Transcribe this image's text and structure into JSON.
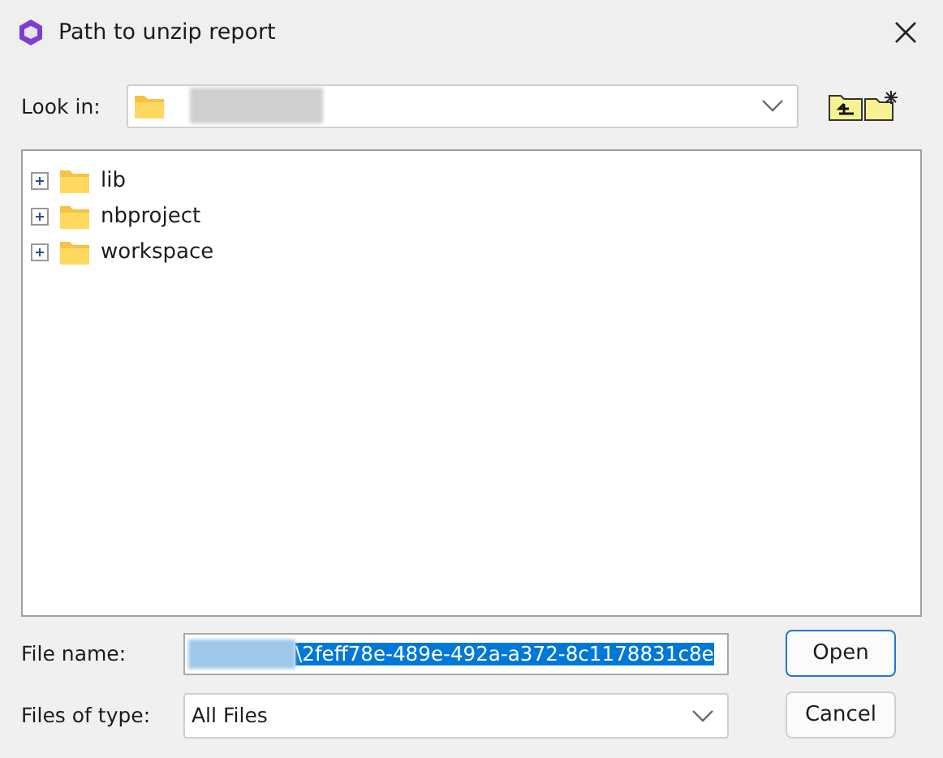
{
  "window": {
    "title": "Path to unzip report"
  },
  "look_in": {
    "label": "Look in:",
    "value_redacted": true
  },
  "toolbar": [
    {
      "kind": "up-folder"
    },
    {
      "kind": "new-folder"
    }
  ],
  "tree": [
    {
      "label": "lib",
      "expanded": false
    },
    {
      "label": "nbproject",
      "expanded": false
    },
    {
      "label": "workspace",
      "expanded": false
    }
  ],
  "file_name": {
    "label": "File name:",
    "value": "\\2feff78e-489e-492a-a372-8c1178831c8e",
    "value_redacted": true,
    "selected": true
  },
  "files_of_type": {
    "label": "Files of type:",
    "value": "All Files"
  },
  "buttons": [
    {
      "label": "Open",
      "default": true
    },
    {
      "label": "Cancel",
      "default": false
    }
  ]
}
